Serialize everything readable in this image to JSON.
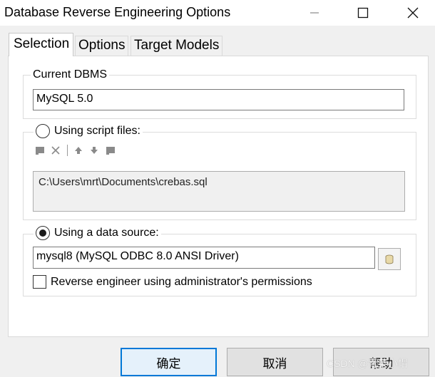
{
  "window": {
    "title": "Database Reverse Engineering Options"
  },
  "tabs": [
    {
      "label": "Selection",
      "active": true
    },
    {
      "label": "Options",
      "active": false
    },
    {
      "label": "Target Models",
      "active": false
    }
  ],
  "current_dbms": {
    "legend": "Current DBMS",
    "value": "MySQL 5.0"
  },
  "script_files": {
    "label": "Using script files:",
    "selected": false,
    "toolbar_icons": [
      "add-file-icon",
      "delete-icon",
      "move-up-icon",
      "move-down-icon",
      "folder-icon"
    ],
    "files": "C:\\Users\\mrt\\Documents\\crebas.sql"
  },
  "data_source": {
    "label": "Using a data source:",
    "selected": true,
    "value": "mysql8 (MySQL ODBC 8.0 ANSI Driver)",
    "admin_checkbox_label": "Reverse engineer using administrator's permissions",
    "admin_checked": false
  },
  "buttons": {
    "ok": "确定",
    "cancel": "取消",
    "help": "帮助"
  },
  "watermark": "CSDN @青菜小帽",
  "colors": {
    "accent": "#0078d7",
    "panel_bg": "#ffffff",
    "dialog_bg": "#f0f0f0"
  }
}
